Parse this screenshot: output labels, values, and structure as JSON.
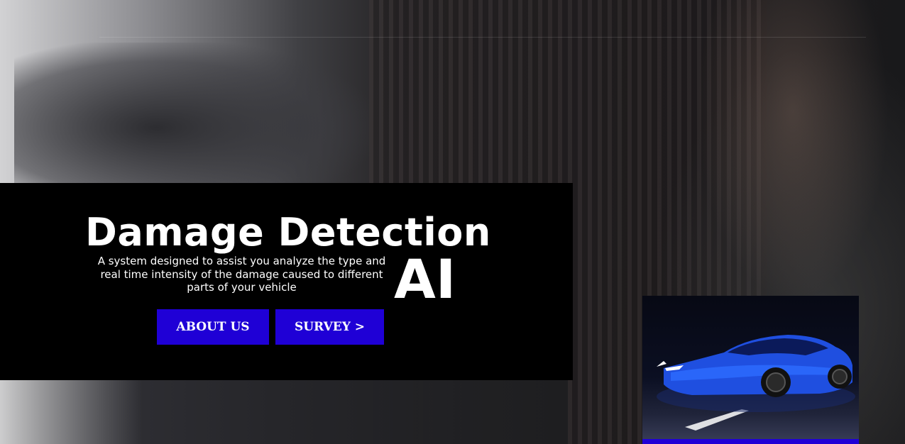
{
  "hero": {
    "title": "Damage Detection",
    "title_suffix": "AI",
    "description": "A system designed to assist you analyze the type and real time intensity of the damage caused to different parts of your vehicle"
  },
  "buttons": {
    "about_label": "ABOUT US",
    "survey_label": "SURVEY >"
  },
  "colors": {
    "accent": "#1f00d6",
    "panel": "#000000",
    "text": "#ffffff"
  },
  "images": {
    "background": "motorcycle-workshop-photo",
    "card": "blue-sports-car-photo"
  }
}
